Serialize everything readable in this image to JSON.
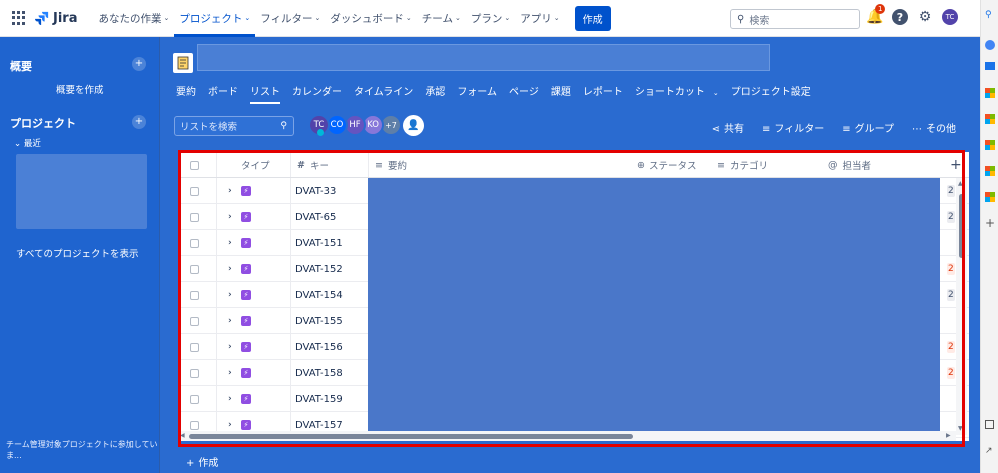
{
  "topnav": {
    "app_name": "Jira",
    "items": [
      {
        "label": "あなたの作業",
        "active": false
      },
      {
        "label": "プロジェクト",
        "active": true
      },
      {
        "label": "フィルター",
        "active": false
      },
      {
        "label": "ダッシュボード",
        "active": false
      },
      {
        "label": "チーム",
        "active": false
      },
      {
        "label": "プラン",
        "active": false
      },
      {
        "label": "アプリ",
        "active": false
      }
    ],
    "create_label": "作成",
    "search_placeholder": "検索",
    "notification_count": "1",
    "user_initials": "TC"
  },
  "sidebar": {
    "overview_heading": "概要",
    "create_overview": "概要を作成",
    "projects_heading": "プロジェクト",
    "recent_label": "最近",
    "view_all_projects": "すべてのプロジェクトを表示",
    "footer_note": "チーム管理対象プロジェクトに参加していま..."
  },
  "project": {
    "tabs": [
      {
        "label": "要約",
        "active": false
      },
      {
        "label": "ボード",
        "active": false
      },
      {
        "label": "リスト",
        "active": true
      },
      {
        "label": "カレンダー",
        "active": false
      },
      {
        "label": "タイムライン",
        "active": false
      },
      {
        "label": "承認",
        "active": false
      },
      {
        "label": "フォーム",
        "active": false
      },
      {
        "label": "ページ",
        "active": false
      },
      {
        "label": "課題",
        "active": false
      },
      {
        "label": "レポート",
        "active": false
      },
      {
        "label": "ショートカット",
        "active": false
      },
      {
        "label": "プロジェクト設定",
        "active": false
      }
    ]
  },
  "toolbar": {
    "list_search_placeholder": "リストを検索",
    "avatars": [
      {
        "initials": "TC",
        "color": "#5243aa"
      },
      {
        "initials": "CO",
        "color": "#0065ff"
      },
      {
        "initials": "HF",
        "color": "#6554c0"
      },
      {
        "initials": "KO",
        "color": "#8777d9"
      }
    ],
    "more_avatars": "+7",
    "share": "共有",
    "filter": "フィルター",
    "group": "グループ",
    "more": "その他"
  },
  "table": {
    "columns": {
      "type": "タイプ",
      "key": "キー",
      "summary": "要約",
      "status": "ステータス",
      "category": "カテゴリ",
      "assignee": "担当者"
    },
    "rows": [
      {
        "key": "DVAT-33",
        "right_val": "2",
        "right_style": "grey"
      },
      {
        "key": "DVAT-65",
        "right_val": "2",
        "right_style": "grey"
      },
      {
        "key": "DVAT-151",
        "right_val": "",
        "right_style": ""
      },
      {
        "key": "DVAT-152",
        "right_val": "2",
        "right_style": "red"
      },
      {
        "key": "DVAT-154",
        "right_val": "2",
        "right_style": "grey"
      },
      {
        "key": "DVAT-155",
        "right_val": "",
        "right_style": ""
      },
      {
        "key": "DVAT-156",
        "right_val": "2",
        "right_style": "red"
      },
      {
        "key": "DVAT-158",
        "right_val": "2",
        "right_style": "red"
      },
      {
        "key": "DVAT-159",
        "right_val": "",
        "right_style": ""
      },
      {
        "key": "DVAT-157",
        "right_val": "",
        "right_style": ""
      }
    ]
  },
  "footer": {
    "create_label": "作成"
  },
  "colors": {
    "brand": "#0052cc",
    "sidebar_bg": "#1f64cf",
    "main_bg": "#2a6bd0",
    "highlight_frame": "#e30000",
    "epic": "#904ee2"
  }
}
